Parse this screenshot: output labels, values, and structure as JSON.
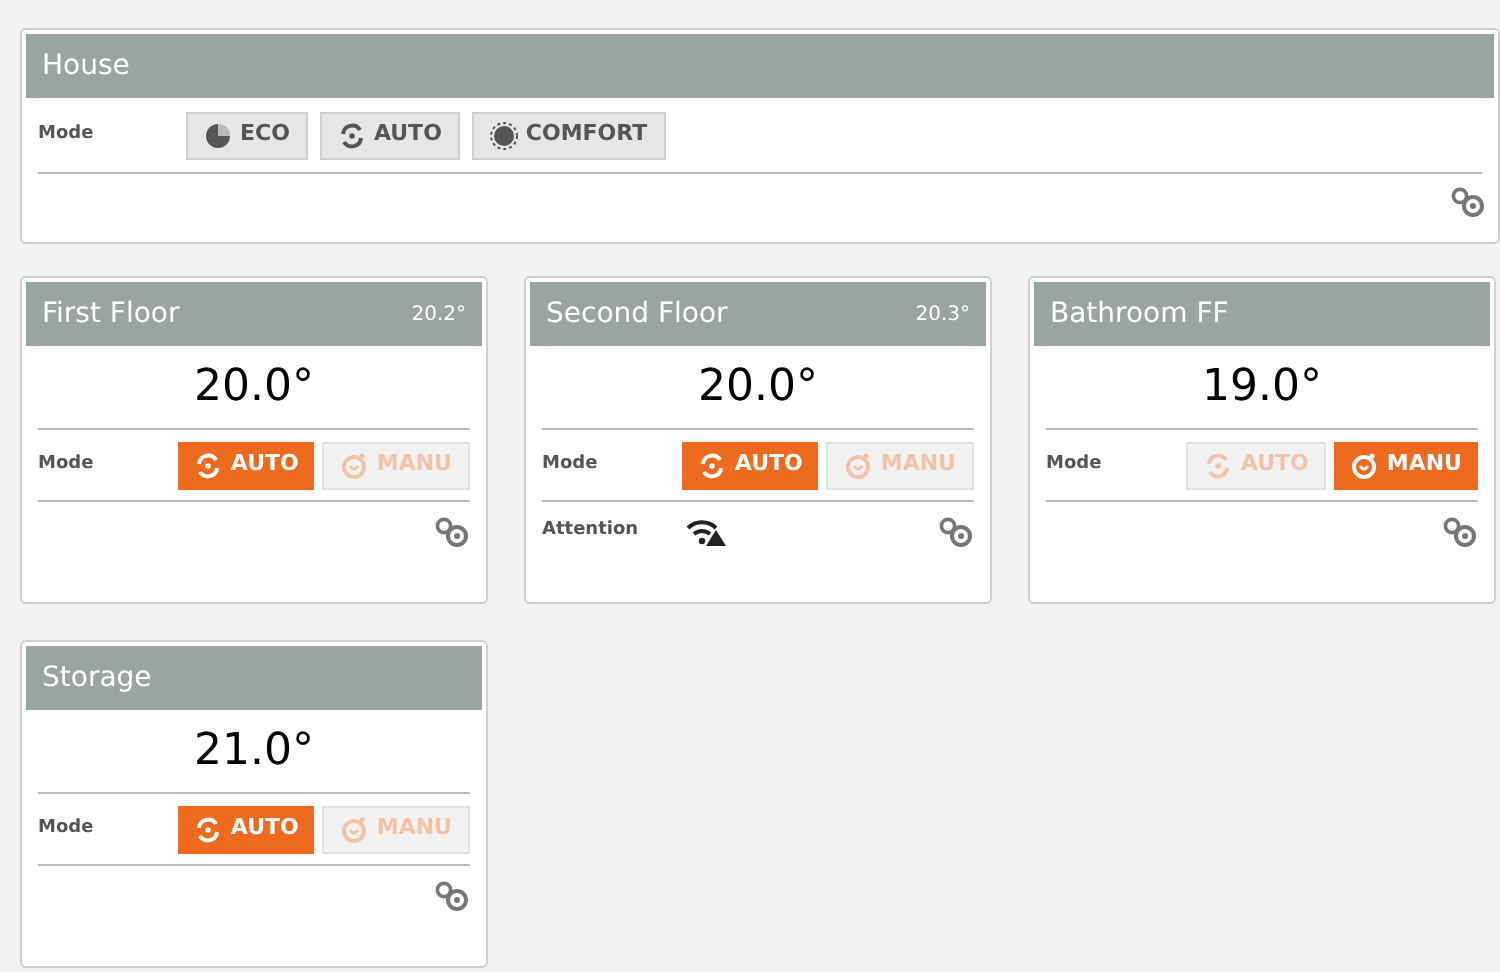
{
  "house": {
    "title": "House",
    "mode_label": "Mode",
    "modes": [
      {
        "kind": "eco",
        "label": "ECO",
        "selected": false
      },
      {
        "kind": "auto",
        "label": "AUTO",
        "selected": false
      },
      {
        "kind": "comfort",
        "label": "COMFORT",
        "selected": false
      }
    ]
  },
  "rooms": [
    {
      "title": "First Floor",
      "current": "20.2°",
      "setpoint": "20.0°",
      "mode_label": "Mode",
      "modes": [
        {
          "kind": "auto",
          "label": "AUTO",
          "selected": true
        },
        {
          "kind": "manu",
          "label": "MANU",
          "selected": false
        }
      ]
    },
    {
      "title": "Second Floor",
      "current": "20.3°",
      "setpoint": "20.0°",
      "mode_label": "Mode",
      "modes": [
        {
          "kind": "auto",
          "label": "AUTO",
          "selected": true
        },
        {
          "kind": "manu",
          "label": "MANU",
          "selected": false
        }
      ],
      "attention": "Attention"
    },
    {
      "title": "Bathroom FF",
      "setpoint": "19.0°",
      "mode_label": "Mode",
      "modes": [
        {
          "kind": "auto",
          "label": "AUTO",
          "selected": false
        },
        {
          "kind": "manu",
          "label": "MANU",
          "selected": true
        }
      ]
    },
    {
      "title": "Storage",
      "setpoint": "21.0°",
      "mode_label": "Mode",
      "modes": [
        {
          "kind": "auto",
          "label": "AUTO",
          "selected": true
        },
        {
          "kind": "manu",
          "label": "MANU",
          "selected": false
        }
      ]
    }
  ]
}
